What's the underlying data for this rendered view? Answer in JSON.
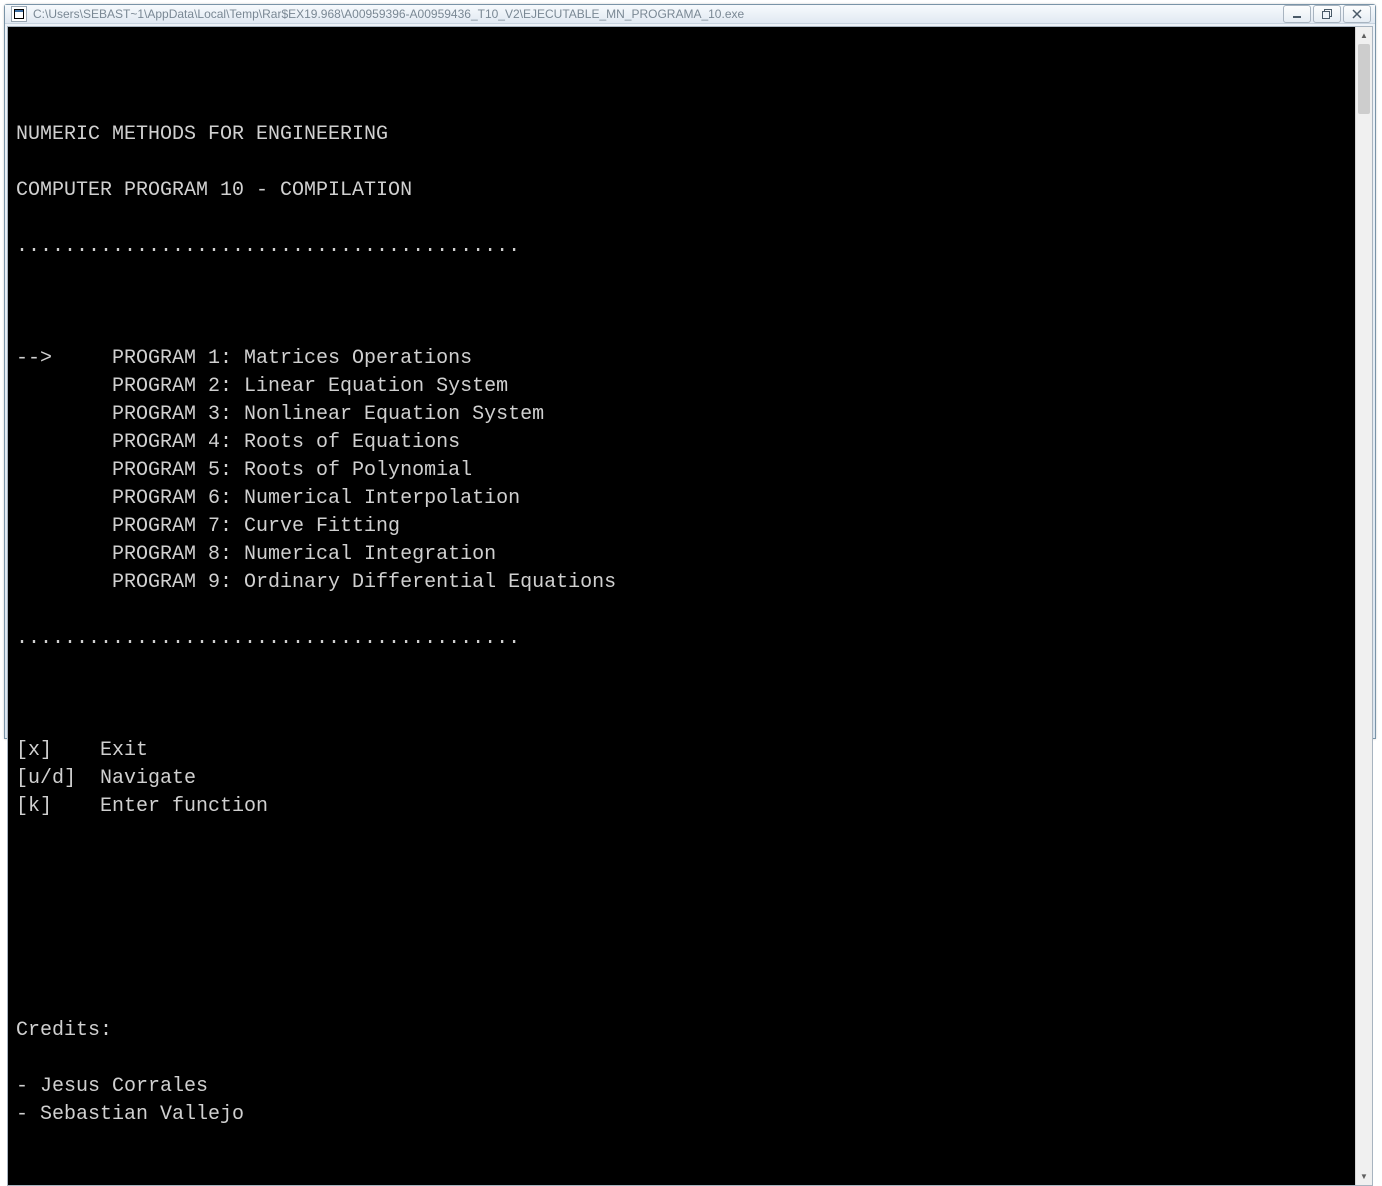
{
  "window": {
    "title": "C:\\Users\\SEBAST~1\\AppData\\Local\\Temp\\Rar$EX19.968\\A00959396-A00959436_T10_V2\\EJECUTABLE_MN_PROGRAMA_10.exe"
  },
  "header": {
    "line1": "NUMERIC METHODS FOR ENGINEERING",
    "line2": "COMPUTER PROGRAM 10 - COMPILATION"
  },
  "separator": "..........................................",
  "pointer": "-->",
  "indent": "        ",
  "menu": [
    {
      "selected": true,
      "label": "PROGRAM 1: Matrices Operations"
    },
    {
      "selected": false,
      "label": "PROGRAM 2: Linear Equation System"
    },
    {
      "selected": false,
      "label": "PROGRAM 3: Nonlinear Equation System"
    },
    {
      "selected": false,
      "label": "PROGRAM 4: Roots of Equations"
    },
    {
      "selected": false,
      "label": "PROGRAM 5: Roots of Polynomial"
    },
    {
      "selected": false,
      "label": "PROGRAM 6: Numerical Interpolation"
    },
    {
      "selected": false,
      "label": "PROGRAM 7: Curve Fitting"
    },
    {
      "selected": false,
      "label": "PROGRAM 8: Numerical Integration"
    },
    {
      "selected": false,
      "label": "PROGRAM 9: Ordinary Differential Equations"
    }
  ],
  "hints": [
    {
      "key": "[x]",
      "pad": "    ",
      "desc": "Exit"
    },
    {
      "key": "[u/d]",
      "pad": "  ",
      "desc": "Navigate"
    },
    {
      "key": "[k]",
      "pad": "    ",
      "desc": "Enter function"
    }
  ],
  "credits": {
    "title": "Credits:",
    "lines": [
      "- Jesus Corrales",
      "- Sebastian Vallejo"
    ]
  }
}
